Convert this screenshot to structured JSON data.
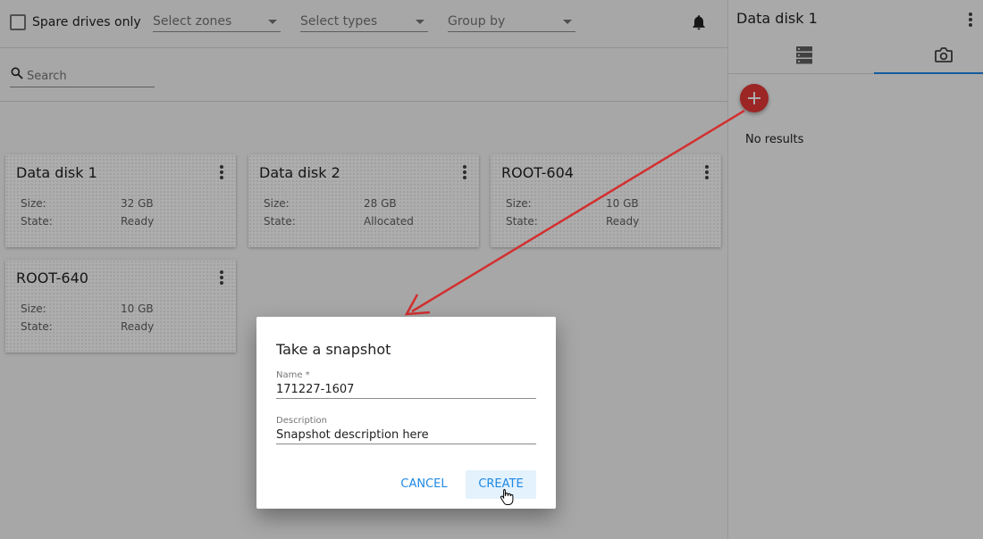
{
  "filters": {
    "spare_drives_label": "Spare drives only",
    "zones_placeholder": "Select zones",
    "types_placeholder": "Select types",
    "group_by_placeholder": "Group by"
  },
  "search": {
    "placeholder": "Search"
  },
  "cards": [
    {
      "title": "Data disk 1",
      "size_label": "Size:",
      "size": "32 GB",
      "state_label": "State:",
      "state": "Ready"
    },
    {
      "title": "Data disk 2",
      "size_label": "Size:",
      "size": "28 GB",
      "state_label": "State:",
      "state": "Allocated"
    },
    {
      "title": "ROOT-604",
      "size_label": "Size:",
      "size": "10 GB",
      "state_label": "State:",
      "state": "Ready"
    },
    {
      "title": "ROOT-640",
      "size_label": "Size:",
      "size": "10 GB",
      "state_label": "State:",
      "state": "Ready"
    }
  ],
  "sidebar": {
    "title": "Data disk 1",
    "tabs": [
      {
        "icon": "storage-icon",
        "active": false
      },
      {
        "icon": "camera-icon",
        "active": true
      }
    ],
    "empty_text": "No results"
  },
  "dialog": {
    "title": "Take a snapshot",
    "name_label": "Name *",
    "name_value": "171227-1607",
    "description_label": "Description",
    "description_value": "Snapshot description here",
    "cancel_label": "CANCEL",
    "create_label": "CREATE"
  },
  "colors": {
    "accent": "#1e88e5",
    "fab": "#e53935",
    "annotation_arrow": "#d32f2f"
  }
}
